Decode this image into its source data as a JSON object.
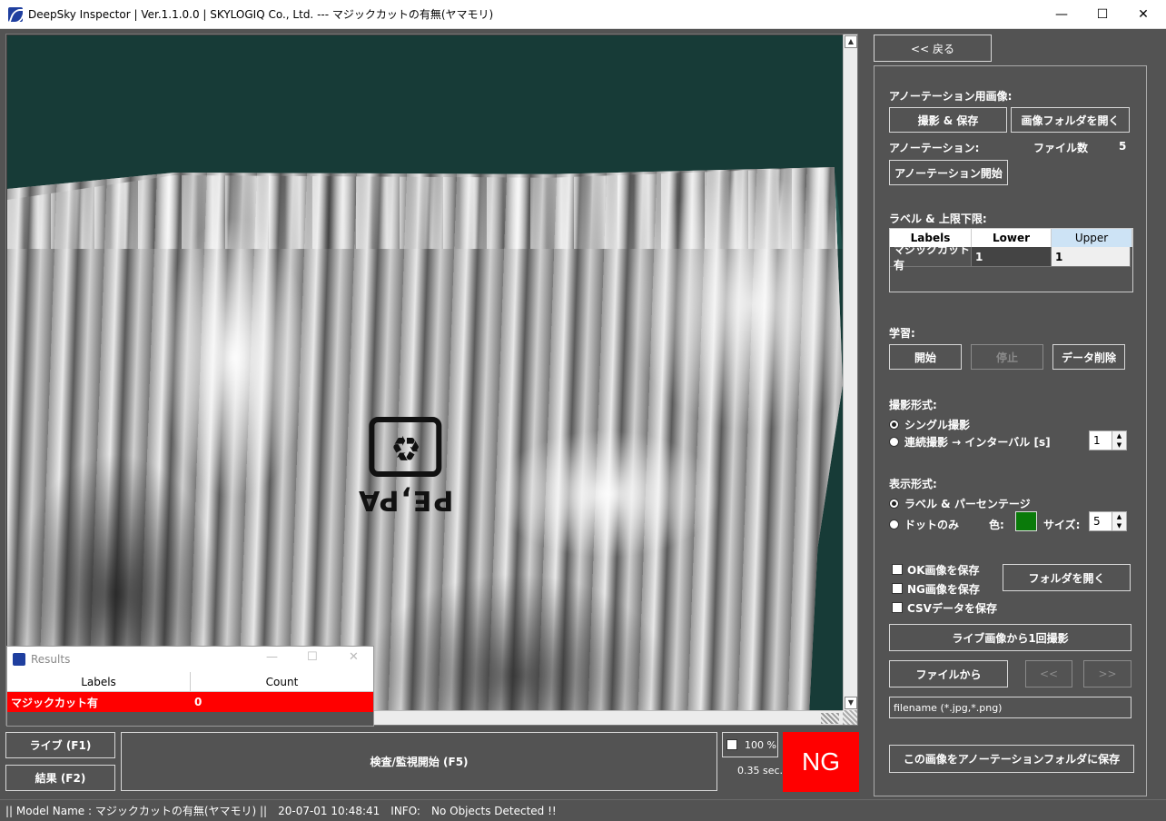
{
  "window": {
    "title": "DeepSky Inspector | Ver.1.1.0.0 | SKYLOGIQ Co., Ltd. --- マジックカットの有無(ヤマモリ)",
    "minimize": "—",
    "maximize": "☐",
    "close": "✕"
  },
  "viewer": {
    "print_text": "PE,PA"
  },
  "results_window": {
    "title": "Results",
    "columns": [
      "Labels",
      "Count"
    ],
    "rows": [
      {
        "label": "マジックカット有",
        "count": "0"
      }
    ],
    "row_color": "#ff0000"
  },
  "bottom": {
    "live_button": "ライブ (F1)",
    "result_button": "結果 (F2)",
    "inspect_button": "検査/監視開始 (F5)",
    "zoom_label": "100 %",
    "elapsed": "0.35 sec.",
    "judgement": "NG",
    "judgement_color": "#ff0000"
  },
  "status": {
    "model": "|| Model Name : マジックカットの有無(ヤマモリ) ||",
    "timestamp": "20-07-01 10:48:41",
    "info_label": "INFO:",
    "info_message": "No Objects Detected !!"
  },
  "panel": {
    "back_button": "<< 戻る",
    "annotation_images_label": "アノーテーション用画像:",
    "capture_save_button": "撮影 & 保存",
    "open_image_folder_button": "画像フォルダを開く",
    "annotation_label": "アノーテーション:",
    "file_count_label": "ファイル数",
    "file_count": "5",
    "annotation_start_button": "アノーテーション開始",
    "labels_limits_label": "ラベル & 上限下限:",
    "table_columns": [
      "Labels",
      "Lower",
      "Upper"
    ],
    "table_rows": [
      {
        "label": "マジックカット有",
        "lower": "1",
        "upper": "1"
      }
    ],
    "training_label": "学習:",
    "train_start_button": "開始",
    "train_stop_button": "停止",
    "delete_data_button": "データ削除",
    "capture_mode_label": "撮影形式:",
    "single_capture": "シングル撮影",
    "continuous_capture": "連続撮影 → インターバル [s]",
    "interval_value": "1",
    "display_mode_label": "表示形式:",
    "label_percentage": "ラベル & パーセンテージ",
    "dots_only": "ドットのみ",
    "color_label": "色:",
    "dot_color": "#0a7a0a",
    "size_label": "サイズ:",
    "size_value": "5",
    "save_ok": "OK画像を保存",
    "save_ng": "NG画像を保存",
    "save_csv": "CSVデータを保存",
    "open_folder_button": "フォルダを開く",
    "capture_once_button": "ライブ画像から1回撮影",
    "from_file_button": "ファイルから",
    "prev_button": "<<",
    "next_button": ">>",
    "filename_text": "filename (*.jpg,*.png)",
    "save_to_annotation_button": "この画像をアノーテーションフォルダに保存"
  }
}
